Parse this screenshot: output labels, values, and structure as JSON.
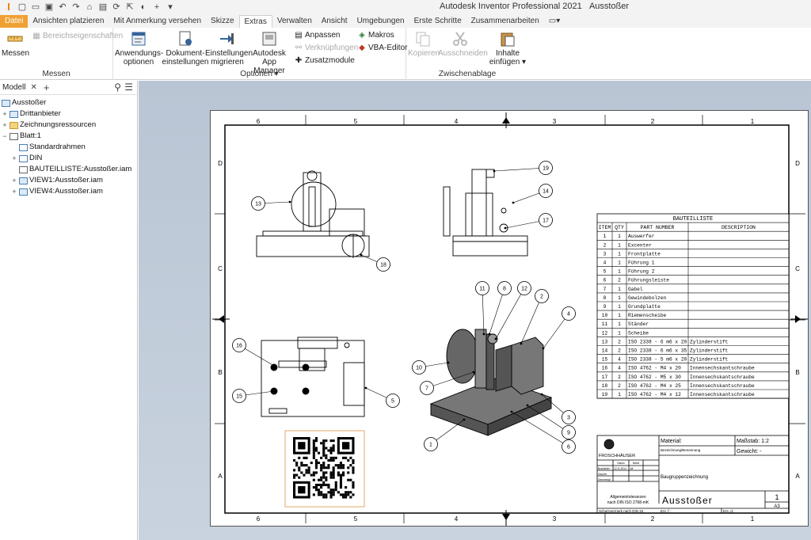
{
  "app": {
    "title": "Autodesk Inventor Professional 2021",
    "document": "Ausstoßer"
  },
  "tabs": [
    "Datei",
    "Ansichten platzieren",
    "Mit Anmerkung versehen",
    "Skizze",
    "Extras",
    "Verwalten",
    "Ansicht",
    "Umgebungen",
    "Erste Schritte",
    "Zusammenarbeiten"
  ],
  "active_tab": "Extras",
  "ribbon": {
    "messen": {
      "label": "Messen",
      "bereich": "Bereichseigenschaften",
      "panel": "Messen"
    },
    "optionen": {
      "anwendung": [
        "Anwendungs-",
        "optionen"
      ],
      "dokument": [
        "Dokument-",
        "einstellungen"
      ],
      "einstellungen": [
        "Einstellungen",
        "migrieren"
      ],
      "appmanager": [
        "Autodesk",
        "App Manager"
      ],
      "anpassen": "Anpassen",
      "verknuepfungen": "Verknüpfungen",
      "zusatzmodule": "Zusatzmodule",
      "makros": "Makros",
      "vba": "VBA-Editor",
      "panel": "Optionen ▾"
    },
    "zwischenablage": {
      "kopieren": "Kopieren",
      "ausschneiden": "Ausschneiden",
      "inhalte": [
        "Inhalte",
        "einfügen"
      ],
      "panel": "Zwischenablage"
    }
  },
  "browser": {
    "tab": "Modell",
    "nodes": [
      "Ausstoßer",
      "Drittanbieter",
      "Zeichnungsressourcen",
      "Blatt:1",
      "Standardrahmen",
      "DIN",
      "BAUTEILLISTE:Ausstoßer.iam",
      "VIEW1:Ausstoßer.iam",
      "VIEW4:Ausstoßer.iam"
    ]
  },
  "drawing": {
    "zones_top": [
      "6",
      "5",
      "4",
      "3",
      "2",
      "1"
    ],
    "zones_side": [
      "D",
      "C",
      "B",
      "A"
    ],
    "balloons": [
      "1",
      "2",
      "3",
      "4",
      "5",
      "6",
      "7",
      "8",
      "9",
      "10",
      "11",
      "12",
      "13",
      "14",
      "15",
      "16",
      "17",
      "18",
      "19"
    ],
    "bom": {
      "title": "BAUTEILLISTE",
      "headers": [
        "ITEM",
        "QTY",
        "PART NUMBER",
        "DESCRIPTION"
      ],
      "rows": [
        [
          "1",
          "1",
          "Auswerfer",
          ""
        ],
        [
          "2",
          "1",
          "Excenter",
          ""
        ],
        [
          "3",
          "1",
          "Frontplatte",
          ""
        ],
        [
          "4",
          "1",
          "Führung 1",
          ""
        ],
        [
          "5",
          "1",
          "Führung 2",
          ""
        ],
        [
          "6",
          "2",
          "Führungsleiste",
          ""
        ],
        [
          "7",
          "1",
          "Gabel",
          ""
        ],
        [
          "8",
          "1",
          "Gewindebolzen",
          ""
        ],
        [
          "9",
          "1",
          "Grundplatte",
          ""
        ],
        [
          "10",
          "1",
          "Riemenscheibe",
          ""
        ],
        [
          "11",
          "1",
          "Ständer",
          ""
        ],
        [
          "12",
          "1",
          "Scheibe",
          ""
        ],
        [
          "13",
          "2",
          "ISO 2338 - 6 m6 x 20",
          "Zylinderstift"
        ],
        [
          "14",
          "2",
          "ISO 2338 - 6 m6 x 35",
          "Zylinderstift"
        ],
        [
          "15",
          "4",
          "ISO 2338 - 5 m6 x 20",
          "Zylinderstift"
        ],
        [
          "16",
          "4",
          "ISO 4762 - M4 x 20",
          "Innensechskantschraube"
        ],
        [
          "17",
          "2",
          "ISO 4762 - M5 x 30",
          "Innensechskantschraube"
        ],
        [
          "18",
          "2",
          "ISO 4762 - M4 x 25",
          "Innensechskantschraube"
        ],
        [
          "19",
          "1",
          "ISO 4762 - M4 x 12",
          "Innensechskantschraube"
        ]
      ]
    },
    "titleblock": {
      "company": "FROSCHHÄUSER",
      "material": "Material:",
      "massstab": "Maßstab: 1:2",
      "bezeichnung": "Bezeichnung/Benennung",
      "gewicht": "Gewicht: -",
      "doctype": "Baugruppenzeichnung",
      "name": "Ausstoßer",
      "sheet_no": "1",
      "format": "A3",
      "toleranz": [
        "Allgemeintoleranzen",
        "nach DIN ISO 2768-mK"
      ],
      "schutz": "Schutzvermerk nach DIN 34",
      "ers_f": "Ers. f.:",
      "ers_d": "Ers. d.:",
      "rows_labels": [
        "Bearbeitet",
        "Geprüft",
        "Genehmigt"
      ],
      "cols_labels": [
        "Datum",
        "Name"
      ],
      "date": "12.11.2014",
      "user": "Jdf"
    }
  }
}
